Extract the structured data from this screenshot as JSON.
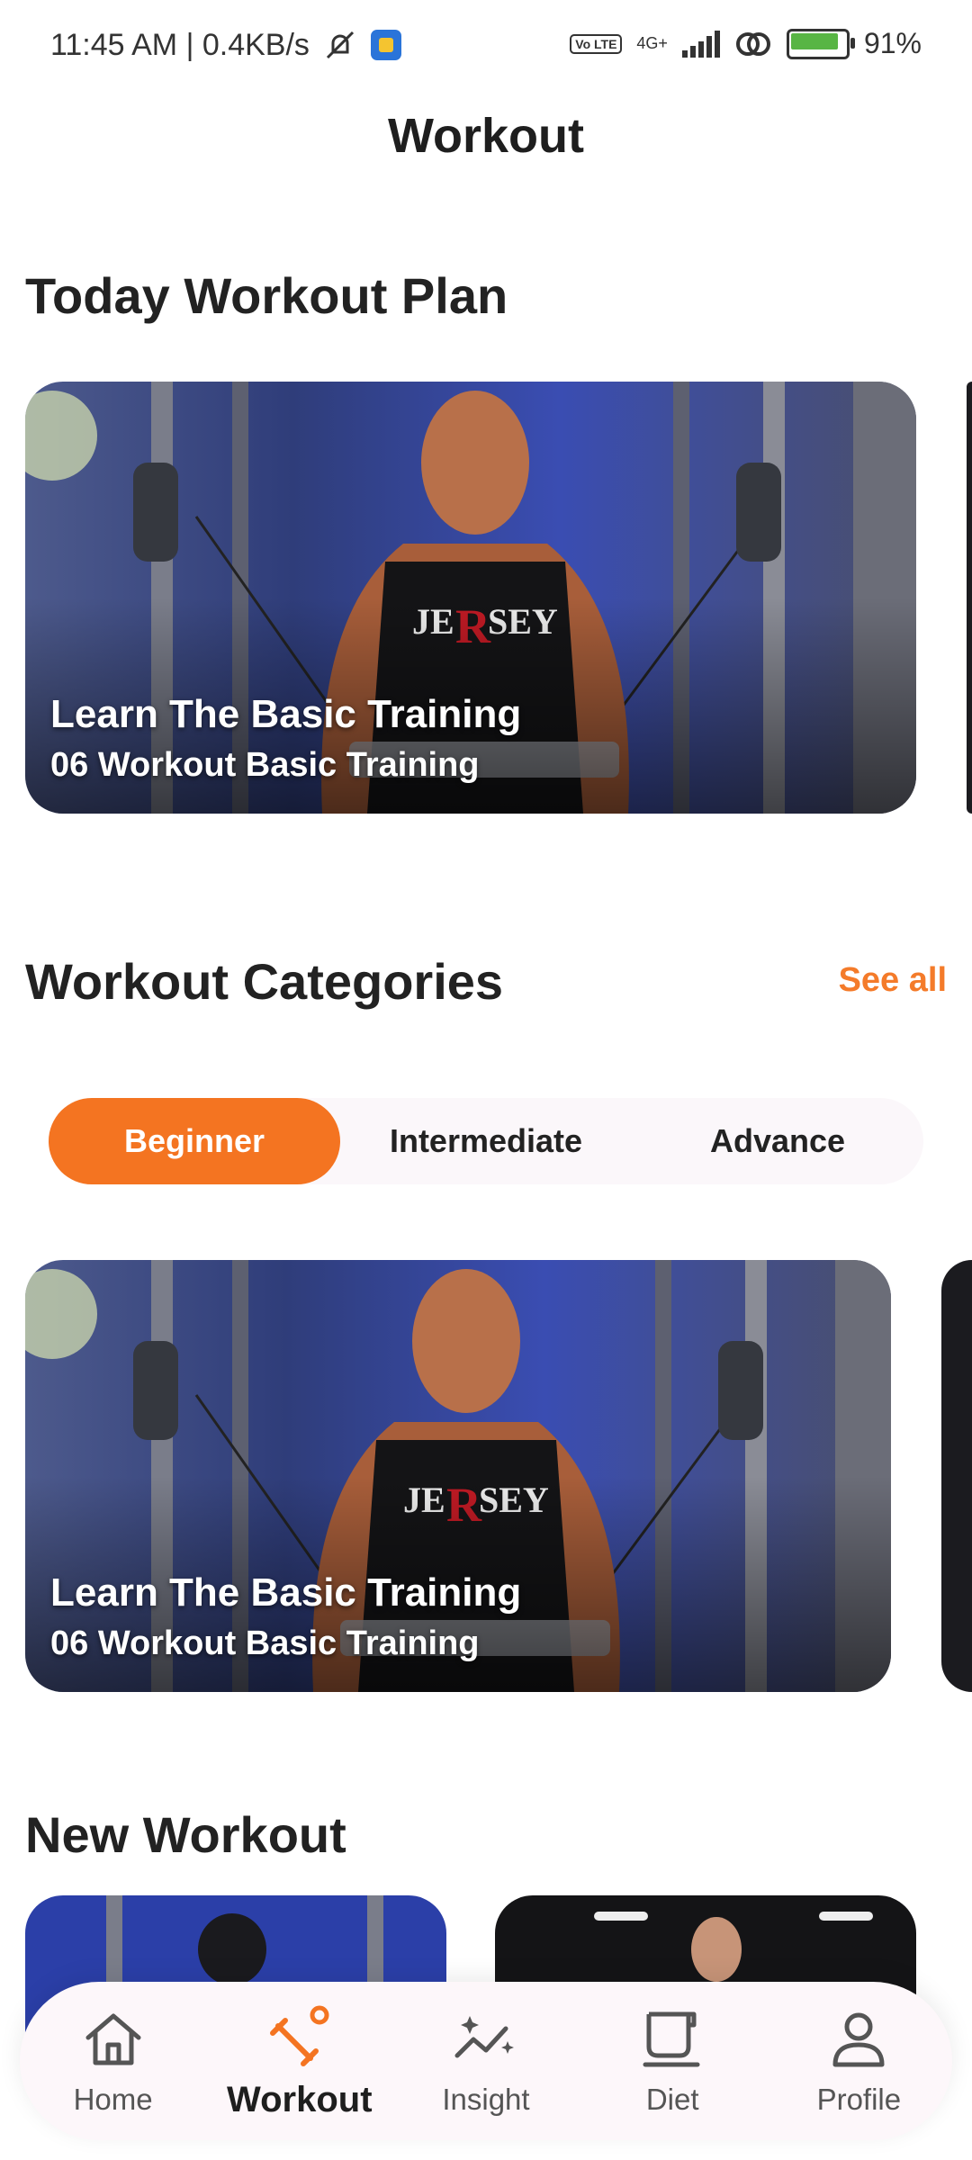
{
  "status_bar": {
    "time": "11:45 AM | 0.4KB/s",
    "network": "4G+",
    "volte": "Vo LTE",
    "battery": "91%"
  },
  "header": {
    "title": "Workout"
  },
  "today_plan": {
    "heading": "Today Workout Plan",
    "card": {
      "title": "Learn The Basic Training",
      "subtitle": "06 Workout Basic Training"
    }
  },
  "categories": {
    "heading": "Workout Categories",
    "see_all": "See all",
    "tabs": [
      {
        "label": "Beginner",
        "active": true
      },
      {
        "label": "Intermediate",
        "active": false
      },
      {
        "label": "Advance",
        "active": false
      }
    ],
    "card": {
      "title": "Learn The Basic Training",
      "subtitle": "06 Workout Basic Training"
    }
  },
  "new_workout": {
    "heading": "New Workout"
  },
  "bottom_nav": {
    "items": [
      {
        "label": "Home",
        "icon": "home-icon",
        "active": false
      },
      {
        "label": "Workout",
        "icon": "dumbbell-icon",
        "active": true
      },
      {
        "label": "Insight",
        "icon": "sparkle-chart-icon",
        "active": false
      },
      {
        "label": "Diet",
        "icon": "cup-icon",
        "active": false
      },
      {
        "label": "Profile",
        "icon": "person-icon",
        "active": false
      }
    ]
  },
  "colors": {
    "accent": "#f47421",
    "text": "#222222",
    "nav_bg": "#fdf7fa"
  }
}
